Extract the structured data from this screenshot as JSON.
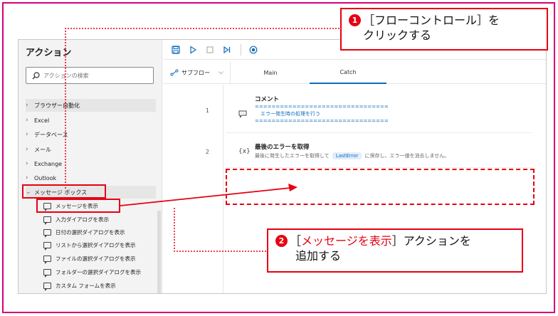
{
  "annotations": {
    "step1": {
      "number": "1",
      "text_line1": "［フローコントロール］を",
      "text_line2": "クリックする"
    },
    "step2": {
      "number": "2",
      "text_prefix": "［",
      "highlight": "メッセージを表示",
      "text_suffix": "］アクションを",
      "text_line2": "追加する"
    },
    "accent_color": "#e60012"
  },
  "left_pane": {
    "title": "アクション",
    "search": {
      "placeholder": "アクションの検索",
      "icon": "search-icon"
    },
    "categories": [
      {
        "label": "ブラウザー自動化",
        "expanded": false
      },
      {
        "label": "Excel",
        "expanded": false
      },
      {
        "label": "データベース",
        "expanded": false
      },
      {
        "label": "メール",
        "expanded": false
      },
      {
        "label": "Exchange",
        "expanded": false
      },
      {
        "label": "Outlook",
        "expanded": false
      },
      {
        "label": "メッセージ ボックス",
        "expanded": true
      }
    ],
    "message_box_actions": [
      "メッセージを表示",
      "入力ダイアログを表示",
      "日付の選択ダイアログを表示",
      "リストから選択ダイアログを表示",
      "ファイルの選択ダイアログを表示",
      "フォルダーの選択ダイアログを表示",
      "カスタム フォームを表示"
    ]
  },
  "toolbar": {
    "buttons": [
      "save-icon",
      "run-icon",
      "stop-icon",
      "run-next-icon",
      "record-icon"
    ]
  },
  "tabs": {
    "subflow_label": "サブフロー",
    "items": [
      {
        "label": "Main",
        "active": false
      },
      {
        "label": "Catch",
        "active": true
      }
    ]
  },
  "flow": {
    "steps": [
      {
        "number": "1",
        "title": "コメント",
        "icon": "comment-icon",
        "body_lines": [
          "================================",
          "エラー発生時の処理を行う",
          "================================"
        ]
      },
      {
        "number": "2",
        "title": "最後のエラーを取得",
        "icon": "variable-icon",
        "icon_text": "{x}",
        "desc_before": "最後に発生したエラーを取得して",
        "variable": "LastError",
        "desc_after": "に保存し、エラー値を消去しません。"
      }
    ]
  }
}
